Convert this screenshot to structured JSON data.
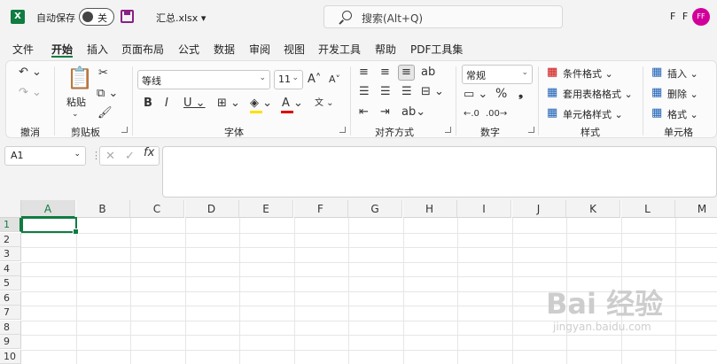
{
  "titlebar": {
    "logo_letter": "X",
    "autosave_label": "自动保存",
    "autosave_state": "关",
    "filename": "汇总.xlsx",
    "filename_caret": "▾",
    "search_placeholder": "搜索(Alt+Q)",
    "user_initials": "F F",
    "avatar_initials": "FF"
  },
  "tabs": [
    "文件",
    "开始",
    "插入",
    "页面布局",
    "公式",
    "数据",
    "审阅",
    "视图",
    "开发工具",
    "帮助",
    "PDF工具集"
  ],
  "active_tab": "开始",
  "ribbon": {
    "undo": {
      "label": "撤消"
    },
    "clipboard": {
      "paste": "粘贴",
      "label": "剪贴板"
    },
    "font": {
      "name": "等线",
      "size": "11",
      "label": "字体"
    },
    "alignment": {
      "label": "对齐方式"
    },
    "number": {
      "format": "常规",
      "percent": "%",
      "comma": "❟",
      "label": "数字"
    },
    "styles": {
      "conditional": "条件格式",
      "table": "套用表格格式",
      "cell": "单元格样式",
      "label": "样式"
    },
    "cells": {
      "insert": "插入",
      "delete": "删除",
      "format": "格式",
      "label": "单元格"
    }
  },
  "formula_bar": {
    "name_box": "A1",
    "fx": "fx",
    "content": ""
  },
  "grid": {
    "columns": [
      "A",
      "B",
      "C",
      "D",
      "E",
      "F",
      "G",
      "H",
      "I",
      "J",
      "K",
      "L",
      "M"
    ],
    "rows": [
      "1",
      "2",
      "3",
      "4",
      "5",
      "6",
      "7",
      "8",
      "9",
      "10"
    ],
    "active_cell": "A1"
  },
  "watermark": {
    "brand": "Bai 经验",
    "url": "jingyan.baidu.com"
  },
  "colors": {
    "accent": "#107c41",
    "save": "#8a1f87",
    "avatar": "#d1009b"
  }
}
